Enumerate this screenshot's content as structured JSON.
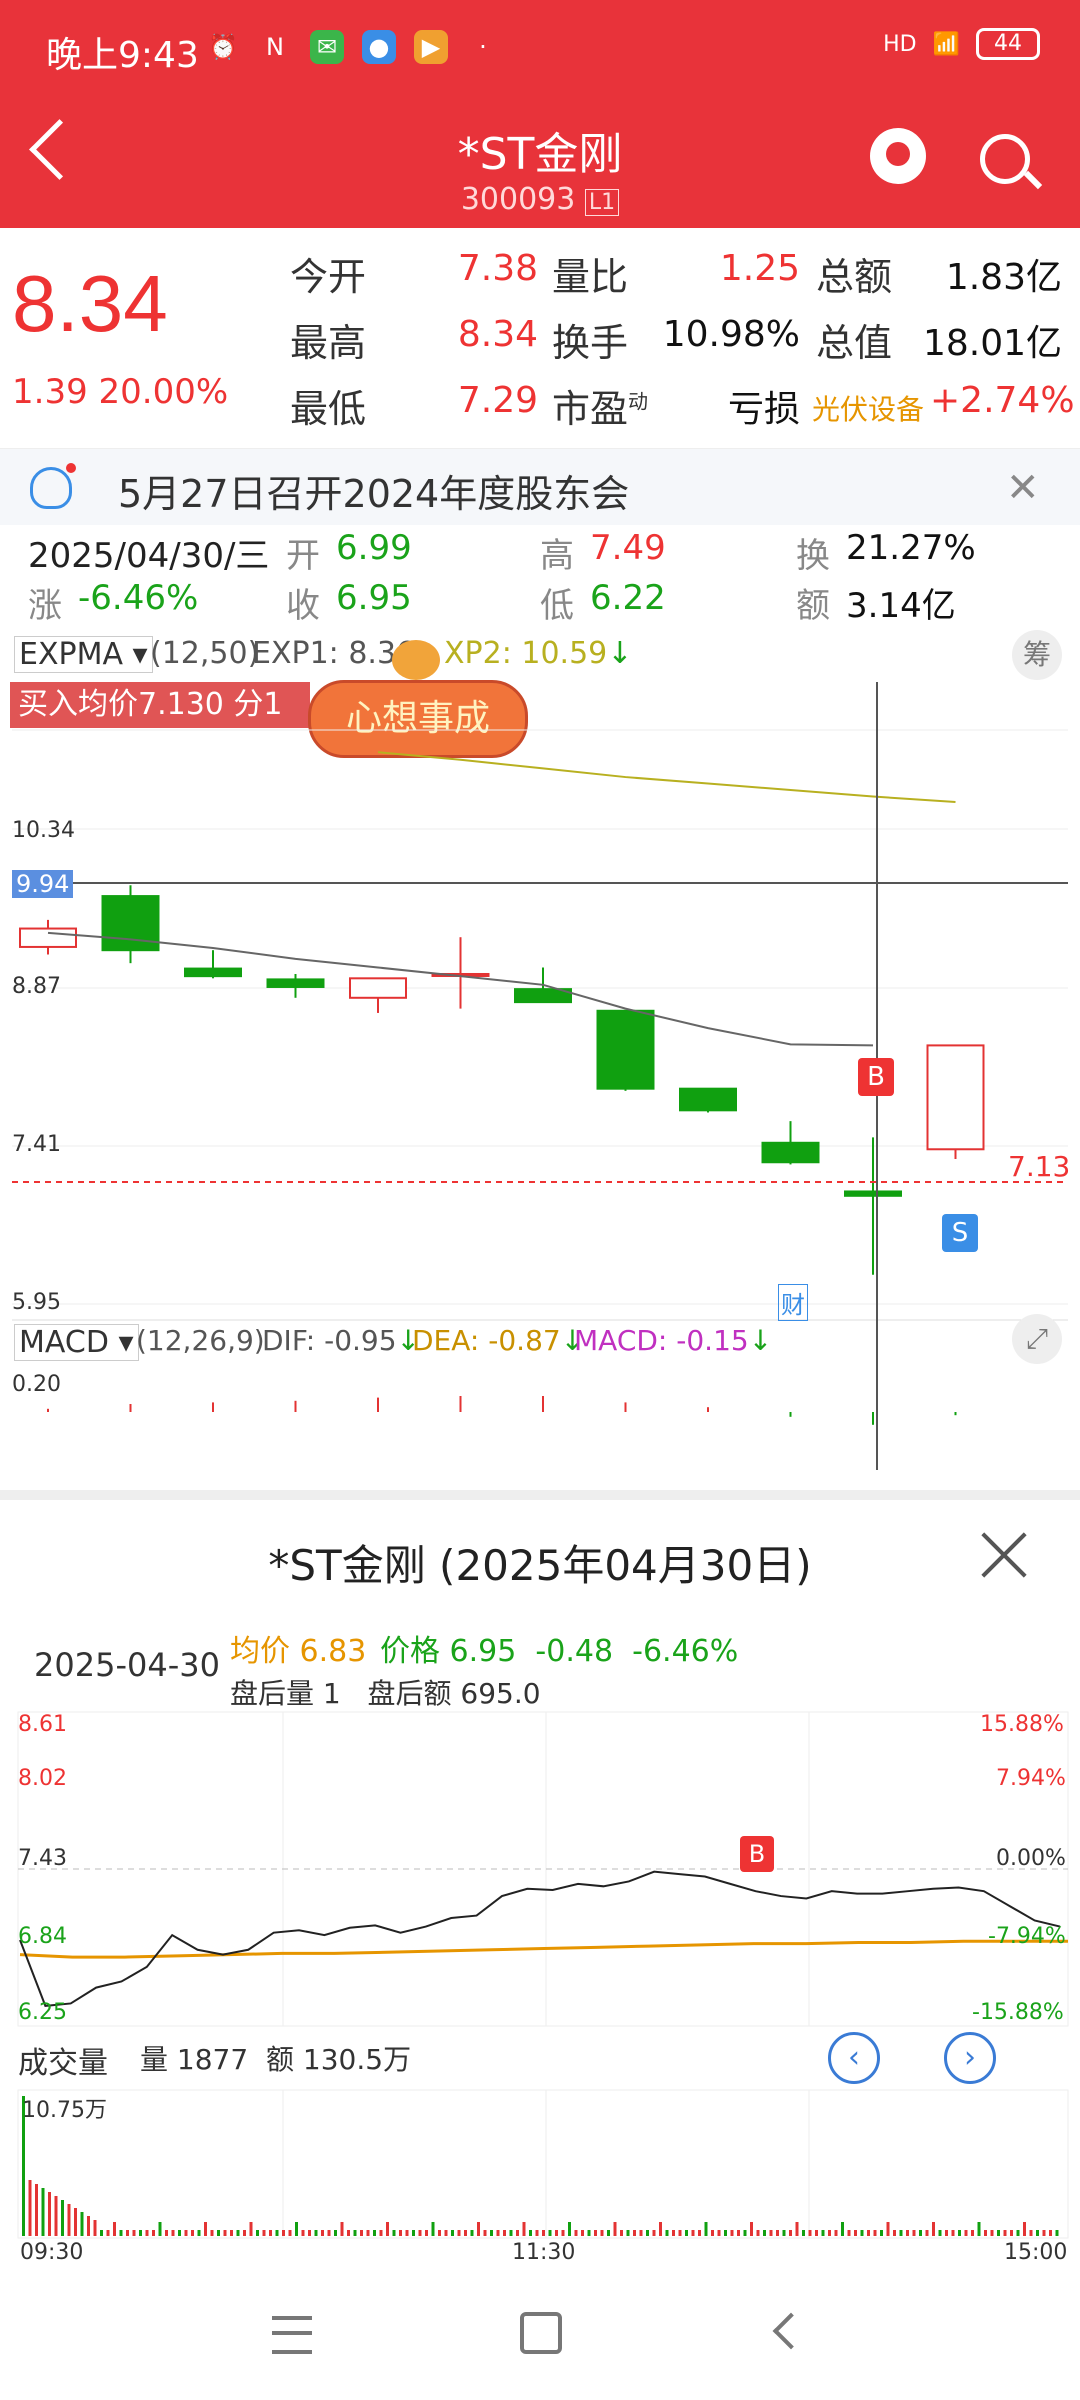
{
  "status_bar": {
    "time": "晚上9:43",
    "battery": "44",
    "network": "HD"
  },
  "header": {
    "title": "*ST金刚",
    "code": "300093",
    "code_badge": "L1"
  },
  "quote": {
    "price": "8.34",
    "change": "1.39",
    "change_pct": "20.00%",
    "fields": [
      {
        "label": "今开",
        "value": "7.38",
        "color": "red"
      },
      {
        "label": "量比",
        "value": "1.25",
        "color": "red"
      },
      {
        "label": "总额",
        "value": "1.83亿",
        "color": "black"
      },
      {
        "label": "最高",
        "value": "8.34",
        "color": "red"
      },
      {
        "label": "换手",
        "value": "10.98%",
        "color": "black"
      },
      {
        "label": "总值",
        "value": "18.01亿",
        "color": "black"
      },
      {
        "label": "最低",
        "value": "7.29",
        "color": "red"
      },
      {
        "label": "市盈",
        "sup": "动",
        "value": "亏损",
        "color": "black"
      },
      {
        "label": "光伏设备",
        "value": "+2.74%",
        "color": "red"
      }
    ]
  },
  "notice": {
    "text": "5月27日召开2024年度股东会"
  },
  "day_detail": {
    "date": "2025/04/30/三",
    "open_label": "开",
    "open": "6.99",
    "high_label": "高",
    "high": "7.49",
    "turnover_label": "换",
    "turnover": "21.27%",
    "change_label": "涨",
    "change": "-6.46%",
    "close_label": "收",
    "close": "6.95",
    "low_label": "低",
    "low": "6.22",
    "amount_label": "额",
    "amount": "3.14亿"
  },
  "kline": {
    "indicator": "EXPMA",
    "params": "(12,50)",
    "exp1": "EXP1: 8.36",
    "exp2": "XP2: 10.59",
    "buy_banner": "买入均价7.130 分1笔",
    "wish_sticker": "心想事成",
    "chou_label": "筹",
    "price_labels": [
      "10.34",
      "9.94",
      "8.87",
      "7.41",
      "5.95"
    ],
    "cost_line": "7.13",
    "buy_marker": "B",
    "sell_marker": "S",
    "finance_marker": "财",
    "candles": [
      {
        "o": 9.25,
        "c": 9.42,
        "h": 9.5,
        "l": 9.18
      },
      {
        "o": 9.72,
        "c": 9.22,
        "h": 9.82,
        "l": 9.1
      },
      {
        "o": 9.05,
        "c": 8.98,
        "h": 9.22,
        "l": 8.96
      },
      {
        "o": 8.95,
        "c": 8.88,
        "h": 9.0,
        "l": 8.78
      },
      {
        "o": 8.78,
        "c": 8.96,
        "h": 8.96,
        "l": 8.64
      },
      {
        "o": 9.0,
        "c": 9.0,
        "h": 9.34,
        "l": 8.68
      },
      {
        "o": 8.86,
        "c": 8.74,
        "h": 9.06,
        "l": 8.74
      },
      {
        "o": 8.66,
        "c": 7.94,
        "h": 8.66,
        "l": 7.92
      },
      {
        "o": 7.94,
        "c": 7.74,
        "h": 7.94,
        "l": 7.72
      },
      {
        "o": 7.44,
        "c": 7.26,
        "h": 7.64,
        "l": 7.24
      },
      {
        "o": 6.99,
        "c": 6.95,
        "h": 7.49,
        "l": 6.22
      },
      {
        "o": 7.38,
        "c": 8.34,
        "h": 8.34,
        "l": 7.29
      }
    ],
    "exp1_line": [
      9.38,
      9.32,
      9.24,
      9.14,
      9.06,
      8.98,
      8.9,
      8.68,
      8.5,
      8.35,
      8.34
    ],
    "exp2_line": [
      11.05,
      10.98,
      10.9,
      10.82,
      10.76,
      10.7,
      10.64,
      10.59
    ]
  },
  "macd": {
    "indicator": "MACD",
    "params": "(12,26,9)",
    "dif": "DIF: -0.95",
    "dea": "DEA: -0.87",
    "macd": "MACD: -0.15",
    "axis_label": "0.20",
    "bars": [
      0.02,
      0.05,
      0.06,
      0.07,
      0.09,
      0.1,
      0.1,
      0.06,
      0.03,
      -0.03,
      -0.08,
      -0.02
    ]
  },
  "popup": {
    "title": "*ST金刚 (2025年04月30日)",
    "date": "2025-04-30",
    "avg_label": "均价",
    "avg": "6.83",
    "price_label": "价格",
    "price": "6.95",
    "change": "-0.48",
    "change_pct": "-6.46%",
    "after_vol_label": "盘后量",
    "after_vol": "1",
    "after_amt_label": "盘后额",
    "after_amt": "695.0",
    "left_axis": [
      "8.61",
      "8.02",
      "7.43",
      "6.84",
      "6.25"
    ],
    "right_axis": [
      "15.88%",
      "7.94%",
      "0.00%",
      "-7.94%",
      "-15.88%"
    ],
    "buy_marker": "B",
    "volume_title": "成交量",
    "volume_label": "量",
    "volume": "1877",
    "amount_label": "额",
    "amount": "130.5万",
    "volume_axis": "10.75万",
    "time_start": "09:30",
    "time_mid": "11:30",
    "time_end": "15:00",
    "price_series": [
      6.84,
      6.3,
      6.32,
      6.45,
      6.5,
      6.62,
      6.88,
      6.76,
      6.72,
      6.76,
      6.9,
      6.92,
      6.88,
      6.94,
      6.96,
      6.9,
      6.95,
      7.02,
      7.04,
      7.2,
      7.26,
      7.25,
      7.3,
      7.28,
      7.32,
      7.4,
      7.38,
      7.36,
      7.3,
      7.24,
      7.2,
      7.18,
      7.24,
      7.22,
      7.22,
      7.24,
      7.26,
      7.27,
      7.24,
      7.12,
      7.0,
      6.95
    ],
    "avg_series": [
      6.72,
      6.7,
      6.7,
      6.71,
      6.72,
      6.73,
      6.73,
      6.74,
      6.75,
      6.76,
      6.77,
      6.78,
      6.79,
      6.8,
      6.81,
      6.81,
      6.82,
      6.82,
      6.83,
      6.83,
      6.83
    ]
  },
  "colors": {
    "brand_red": "#e8333a",
    "up": "#e33333",
    "down": "#10a010",
    "exp2": "#b8b020",
    "avg": "#e69500",
    "macd_line": "#c030c0"
  }
}
